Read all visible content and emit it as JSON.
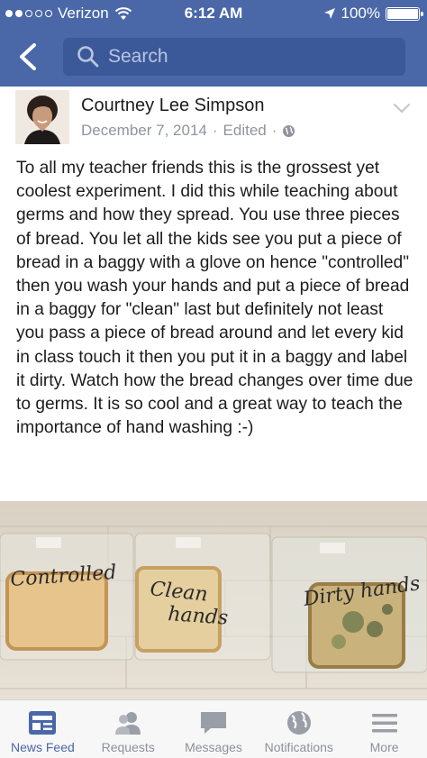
{
  "status_bar": {
    "carrier": "Verizon",
    "time": "6:12 AM",
    "battery": "100%"
  },
  "search": {
    "placeholder": "Search"
  },
  "post": {
    "author": "Courtney Lee Simpson",
    "date": "December 7, 2014",
    "edited": "Edited",
    "separator": "·",
    "text": "To all my teacher friends this is the grossest yet coolest experiment.  I did this while teaching about germs and how they spread. You use three pieces of bread. You let all the kids see you put a piece of bread in a baggy with a glove on hence \"controlled\" then you wash your hands and put a piece of bread in a baggy for \"clean\" last but definitely not least you pass a piece of bread around and let every kid in class touch it then you put it in a baggy and label it dirty. Watch how the bread changes over time due to germs. It is so cool and a great way to teach the importance of hand washing :-)",
    "photo_labels": {
      "bag1": "Controlled",
      "bag2_line1": "Clean",
      "bag2_line2": "hands",
      "bag3": "Dirty hands"
    }
  },
  "tabs": [
    {
      "label": "News Feed",
      "icon": "news-feed-icon",
      "active": true
    },
    {
      "label": "Requests",
      "icon": "requests-icon",
      "active": false
    },
    {
      "label": "Messages",
      "icon": "messages-icon",
      "active": false
    },
    {
      "label": "Notifications",
      "icon": "globe-icon",
      "active": false
    },
    {
      "label": "More",
      "icon": "menu-icon",
      "active": false
    }
  ],
  "colors": {
    "brand_blue": "#4a67a8",
    "search_bg": "#3b5998",
    "tab_inactive": "#8d9199"
  }
}
